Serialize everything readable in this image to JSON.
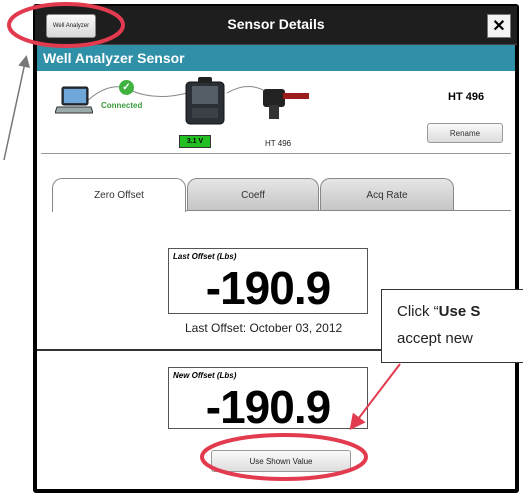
{
  "window": {
    "title": "Sensor Details",
    "app_button_label": "Well Analyzer",
    "close_icon": "close-x-icon"
  },
  "section": {
    "header": "Well Analyzer Sensor"
  },
  "connection": {
    "status": "Connected",
    "battery": "3.1 V",
    "sensor_label": "HT 496",
    "sensor_name": "HT 496",
    "rename_label": "Rename"
  },
  "tabs": [
    {
      "label": "Zero Offset",
      "active": true
    },
    {
      "label": "Coeff",
      "active": false
    },
    {
      "label": "Acq Rate",
      "active": false
    }
  ],
  "last_offset": {
    "label": "Last Offset (Lbs)",
    "value": "-190.9",
    "date_text": "Last Offset: October 03, 2012"
  },
  "new_offset": {
    "label": "New Offset (Lbs)",
    "value": "-190.9"
  },
  "use_button_label": "Use Shown Value",
  "annotation": {
    "prefix": "Click  “",
    "bold": "Use S",
    "line2": "accept new"
  },
  "colors": {
    "header": "#2f90a8",
    "highlight": "#e23a4e",
    "battery": "#22c022"
  }
}
